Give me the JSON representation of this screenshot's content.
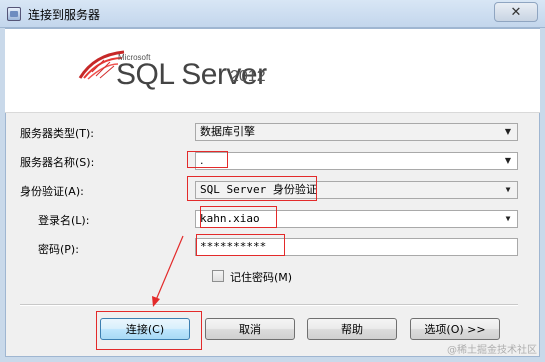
{
  "window": {
    "title": "连接到服务器",
    "close_glyph": "✕"
  },
  "banner": {
    "brand": "Microsoft",
    "product": "SQL Server",
    "version": "2012"
  },
  "form": {
    "server_type_label": "服务器类型(T):",
    "server_type_value": "数据库引擎",
    "server_name_label": "服务器名称(S):",
    "server_name_value": ".",
    "auth_label": "身份验证(A):",
    "auth_value": "SQL Server 身份验证",
    "login_label": "登录名(L):",
    "login_value": "kahn.xiao",
    "password_label": "密码(P):",
    "password_value": "**********",
    "remember_label": "记住密码(M)",
    "remember_checked": false
  },
  "buttons": {
    "connect": "连接(C)",
    "cancel": "取消",
    "help": "帮助",
    "options": "选项(O) >>"
  },
  "annotation_color": "#e32a2a",
  "watermark": "@稀土掘金技术社区"
}
